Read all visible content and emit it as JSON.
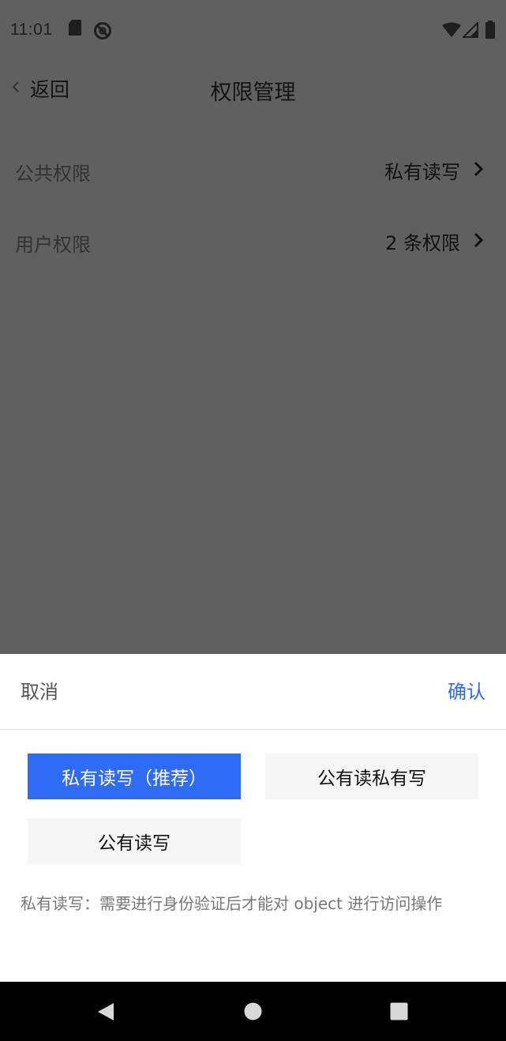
{
  "status_bar": {
    "time": "11:01",
    "icons": [
      "sd-card-icon",
      "do-not-disturb-icon",
      "wifi-icon",
      "cell-signal-icon",
      "battery-icon"
    ]
  },
  "nav": {
    "back_label": "返回",
    "title": "权限管理"
  },
  "settings": [
    {
      "label": "公共权限",
      "value": "私有读写"
    },
    {
      "label": "用户权限",
      "value": "2 条权限"
    }
  ],
  "sheet": {
    "cancel_label": "取消",
    "confirm_label": "确认",
    "options": [
      {
        "label": "私有读写（推荐）",
        "selected": true
      },
      {
        "label": "公有读私有写",
        "selected": false
      },
      {
        "label": "公有读写",
        "selected": false
      }
    ],
    "description": "私有读写：需要进行身份验证后才能对 object 进行访问操作"
  },
  "colors": {
    "accent": "#2f6cf5",
    "overlay": "#606060",
    "sheet_background": "#ffffff",
    "option_background": "#f6f6f6"
  },
  "system_nav": [
    "back-triangle-icon",
    "home-circle-icon",
    "recents-square-icon"
  ]
}
